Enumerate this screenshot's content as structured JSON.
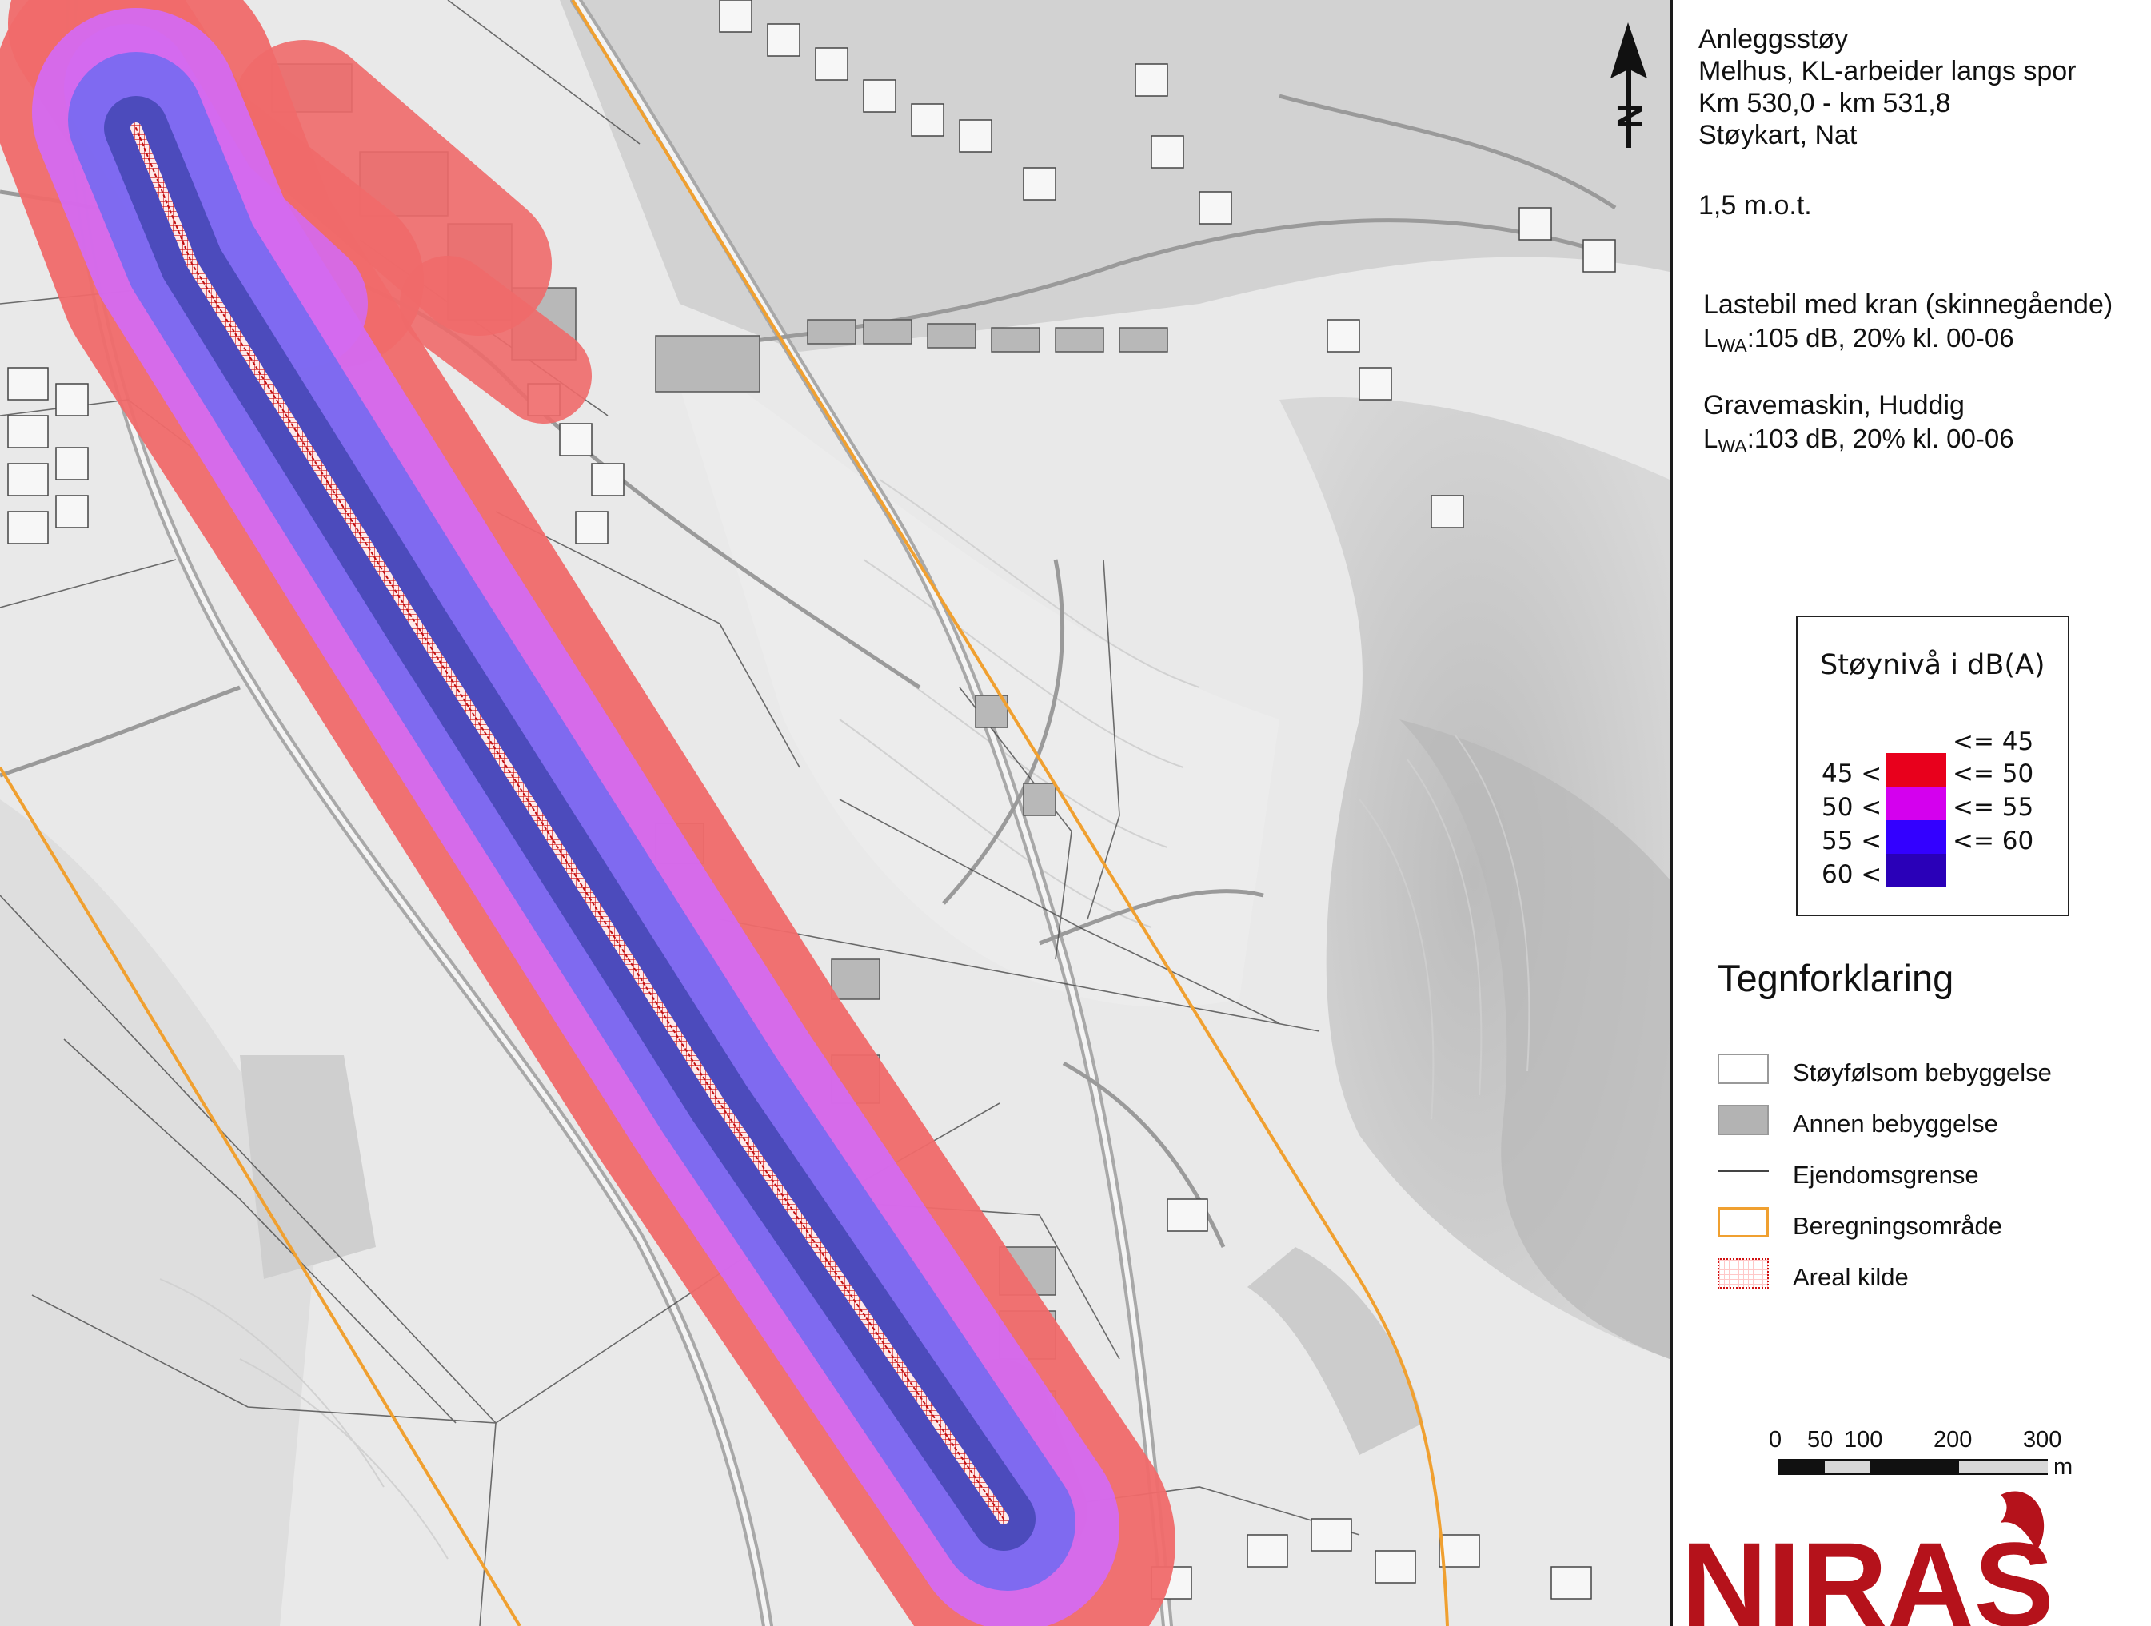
{
  "title": {
    "line1": "Anleggsstøy",
    "line2": "Melhus, KL-arbeider langs spor",
    "line3": "Km 530,0 - km 531,8",
    "line4": "Støykart, Nat",
    "height": "1,5 m.o.t."
  },
  "sources": [
    {
      "name": "Lastebil med kran (skinnegående)",
      "lwa_prefix": "L",
      "lwa_sub": "WA",
      "lwa_value": ":105 dB, 20% kl. 00-06"
    },
    {
      "name": "Gravemaskin, Huddig",
      "lwa_prefix": "L",
      "lwa_sub": "WA",
      "lwa_value": ":103 dB, 20% kl. 00-06"
    }
  ],
  "north_arrow": {
    "label": "N",
    "icon": "north-arrow-icon"
  },
  "noise_legend": {
    "title": "Støynivå i dB(A)",
    "classes": [
      {
        "lower": "",
        "upper": "<= 45",
        "color": "#ffffff"
      },
      {
        "lower": "45 <",
        "upper": "<= 50",
        "color": "#e8001c"
      },
      {
        "lower": "50 <",
        "upper": "<= 55",
        "color": "#d400ee"
      },
      {
        "lower": "55 <",
        "upper": "<= 60",
        "color": "#3300ff"
      },
      {
        "lower": "60 <",
        "upper": "",
        "color": "#2a00b8"
      }
    ]
  },
  "key": {
    "title": "Tegnforklaring",
    "items": [
      {
        "label": "Støyfølsom bebyggelse",
        "symbol": "white-fill"
      },
      {
        "label": "Annen bebyggelse",
        "symbol": "grey-fill"
      },
      {
        "label": "Ejendomsgrense",
        "symbol": "thin-line"
      },
      {
        "label": "Beregningsområde",
        "symbol": "orange-outline"
      },
      {
        "label": "Areal kilde",
        "symbol": "red-dotted-grid"
      }
    ]
  },
  "scale": {
    "ticks": [
      "0",
      "50",
      "100",
      "200",
      "300"
    ],
    "unit": "m"
  },
  "logo": {
    "text": "NIRAS",
    "color": "#b5121b"
  },
  "colors": {
    "zone_45_50": "#f06a6a",
    "zone_50_55": "#d46af0",
    "zone_55_60": "#7a6af0",
    "zone_60_plus": "#4a4ab8",
    "calc_area_border": "#f0a030",
    "map_background": "#e8e8e8"
  }
}
